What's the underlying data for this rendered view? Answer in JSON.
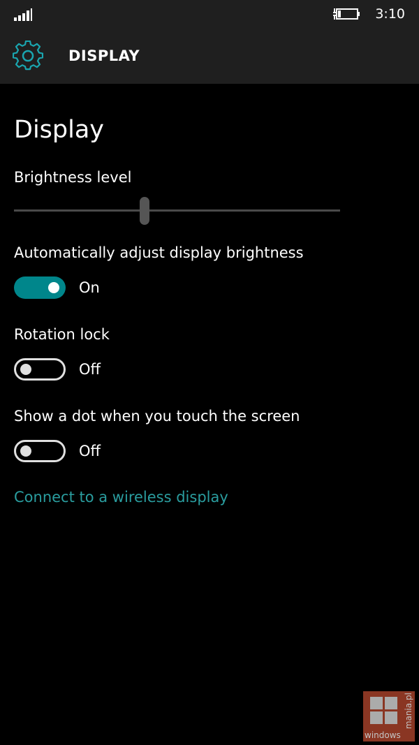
{
  "status_bar": {
    "time": "3:10",
    "signal_icon": "signal-bars-icon",
    "battery_icon": "battery-charging-icon"
  },
  "header": {
    "icon": "gear-icon",
    "title": "DISPLAY"
  },
  "page": {
    "title": "Display"
  },
  "brightness": {
    "label": "Brightness level",
    "value_fraction": 0.4
  },
  "settings": [
    {
      "label": "Automatically adjust display brightness",
      "state": "On",
      "checked": true
    },
    {
      "label": "Rotation lock",
      "state": "Off",
      "checked": false
    },
    {
      "label": "Show a dot when you touch the screen",
      "state": "Off",
      "checked": false
    }
  ],
  "link": {
    "label": "Connect to a wireless display"
  },
  "watermark": {
    "text": "windows",
    "vertical_text": "mania.pl"
  },
  "colors": {
    "accent": "#00868b",
    "link": "#2a9d9f",
    "header_bg": "#1f1f1f",
    "background": "#000000"
  }
}
